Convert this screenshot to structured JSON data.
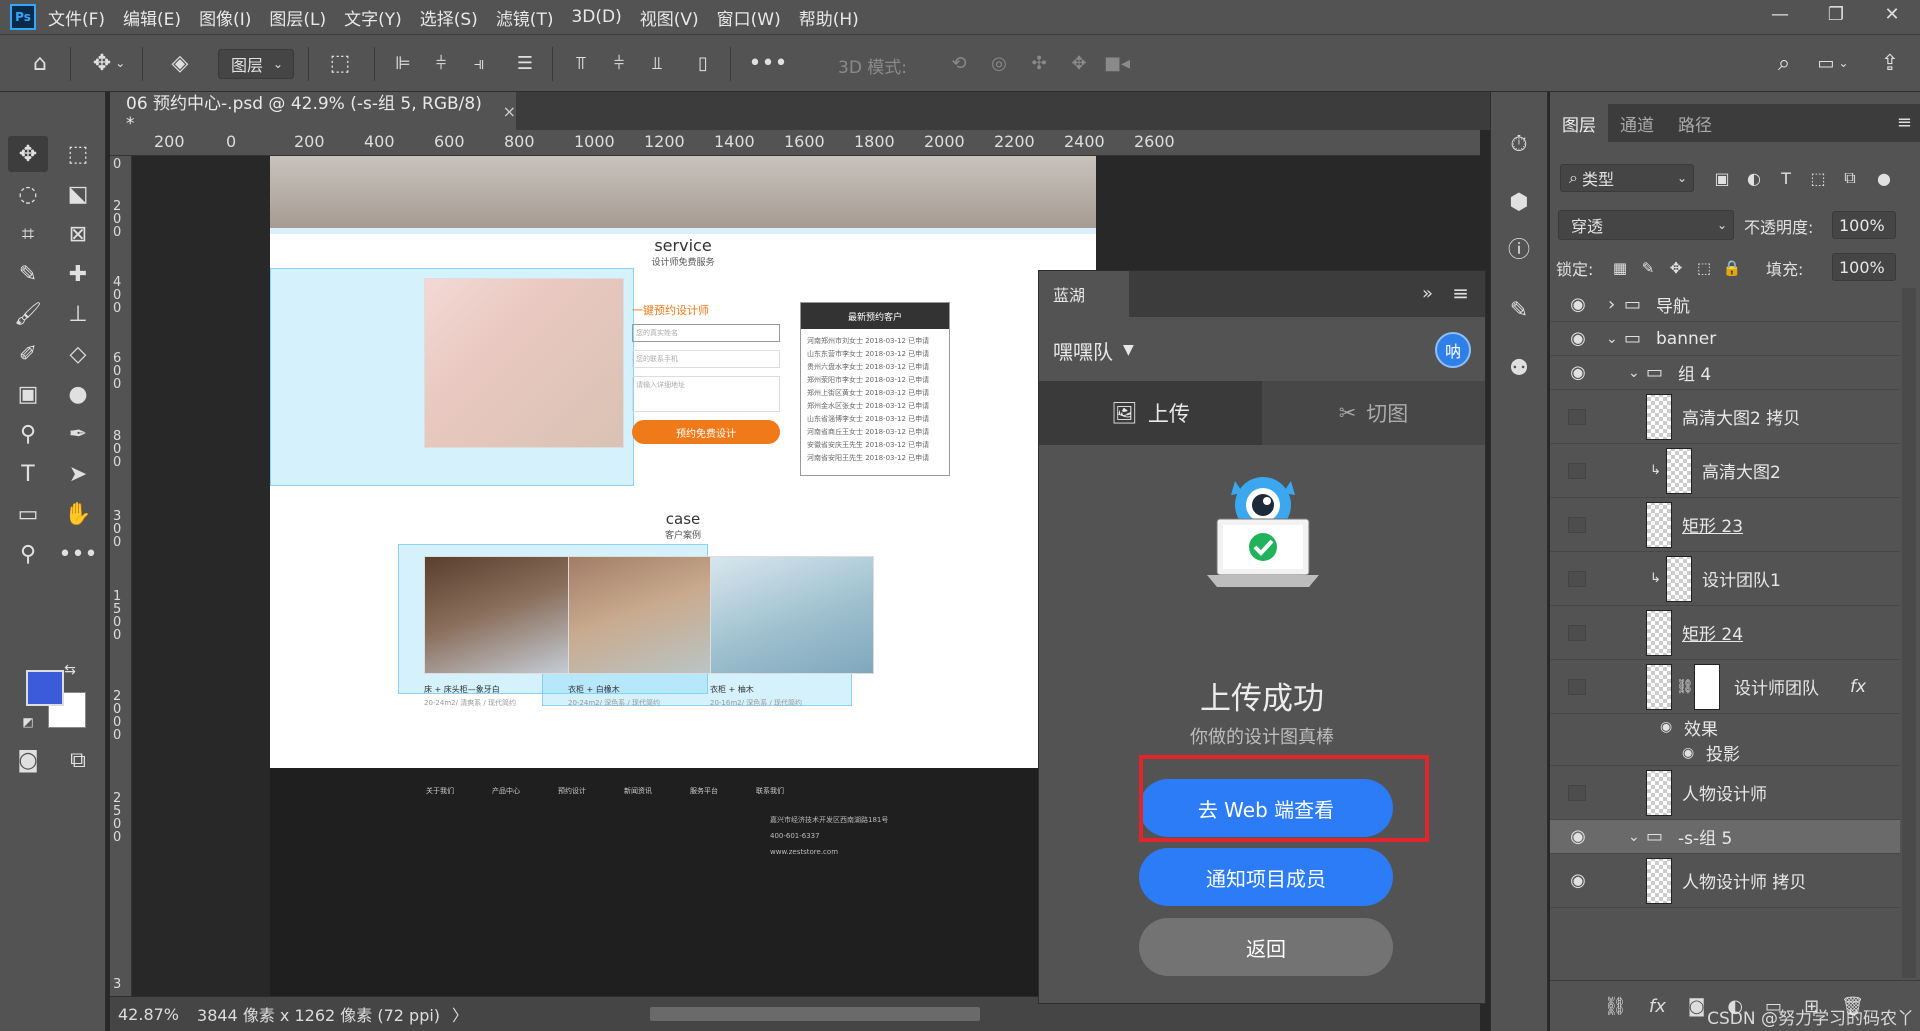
{
  "app": {
    "name": "Ps",
    "menus": [
      "文件(F)",
      "编辑(E)",
      "图像(I)",
      "图层(L)",
      "文字(Y)",
      "选择(S)",
      "滤镜(T)",
      "3D(D)",
      "视图(V)",
      "窗口(W)",
      "帮助(H)"
    ]
  },
  "window_controls": {
    "minimize": "—",
    "restore": "❐",
    "close": "✕"
  },
  "options_bar": {
    "auto_select_target": "图层",
    "mode_3d_label": "3D 模式:"
  },
  "document": {
    "tab_title": "06 预约中心-.psd @ 42.9% (-s-组 5, RGB/8) *",
    "close": "×"
  },
  "ruler": {
    "h_ticks": [
      "200",
      "0",
      "200",
      "400",
      "600",
      "800",
      "1000",
      "1200",
      "1400",
      "1600",
      "1800",
      "2000",
      "2200",
      "2400",
      "2600"
    ],
    "v_ticks": [
      "0",
      "2 0 0",
      "4 0 0",
      "6 0 0",
      "8 0 0",
      "3 0 0",
      "1 5 0 0",
      "2 0 0 0",
      "2 5 0 0",
      "3"
    ]
  },
  "status_bar": {
    "zoom": "42.87%",
    "doc_info": "3844 像素 x 1262 像素 (72 ppi)",
    "arrow": "〉"
  },
  "canvas": {
    "service_title": "service",
    "service_sub": "设计师免费服务",
    "booking_title": "一键预约设计师",
    "booking_name_ph": "您的真实姓名",
    "booking_phone_ph": "您的联系手机",
    "booking_addr_ph": "请输入详细地址",
    "booking_btn": "预约免费设计",
    "recent_title": "最新预约客户",
    "recent_rows": [
      "河南郑州市刘女士 2018-03-12 已申请",
      "山东东营市李女士 2018-03-12 已申请",
      "贵州六盘水李女士 2018-03-12 已申请",
      "郑州荥阳市李女士 2018-03-12 已申请",
      "郑州上街区黄女士 2018-03-12 已申请",
      "郑州金水区张女士 2018-03-12 已申请",
      "山东省淄博李女士 2018-03-12 已申请",
      "河南省商丘王女士 2018-03-12 已申请",
      "安徽省安庆王先生 2018-03-12 已申请",
      "河南省安阳王先生 2018-03-12 已申请"
    ],
    "case_title": "case",
    "case_sub": "客户案例",
    "cases": [
      {
        "title": "床 + 床头柜—象牙白",
        "desc": "20-24m2/ 清爽系 / 现代简约"
      },
      {
        "title": "衣柜 + 白橡木",
        "desc": "20-24m2/ 深色系 / 现代简约"
      },
      {
        "title": "衣柜 + 柚木",
        "desc": "20-16m2/ 深色系 / 现代简约"
      }
    ],
    "footer_cols": [
      "关于我们",
      "产品中心",
      "预约设计",
      "新闻资讯",
      "服务平台",
      "联系我们"
    ],
    "footer_address": "嘉兴市经济技术开发区西南湖路181号",
    "footer_phone": "400-601-6337",
    "footer_site": "www.zeststore.com"
  },
  "plugin": {
    "tab": "蓝湖",
    "expand": "»",
    "menu": "≡",
    "team": "嘿嘿队",
    "team_avatar": "呐",
    "tab_upload": "上传",
    "tab_slice": "切图",
    "success_title": "上传成功",
    "success_sub": "你做的设计图真棒",
    "btn_web": "去 Web 端查看",
    "btn_notify": "通知项目成员",
    "btn_back": "返回"
  },
  "layers_panel": {
    "tabs": [
      "图层",
      "通道",
      "路径"
    ],
    "kind": "类型",
    "blend": "穿透",
    "opacity_label": "不透明度:",
    "opacity": "100%",
    "lock_label": "锁定:",
    "fill_label": "填充:",
    "fill": "100%",
    "layers": [
      {
        "name": "导航",
        "visible": true
      },
      {
        "name": "banner",
        "visible": true
      },
      {
        "name": "组 4",
        "visible": true
      },
      {
        "name": "高清大图2 拷贝",
        "visible": false
      },
      {
        "name": "高清大图2",
        "visible": false
      },
      {
        "name": "矩形 23",
        "visible": false
      },
      {
        "name": "设计团队1",
        "visible": false
      },
      {
        "name": "矩形 24",
        "visible": false
      },
      {
        "name": "设计师团队",
        "visible": false,
        "fx": "fx"
      },
      {
        "name": "效果"
      },
      {
        "name": "投影"
      },
      {
        "name": "人物设计师",
        "visible": false
      },
      {
        "name": "-s-组 5",
        "visible": true
      },
      {
        "name": "人物设计师 拷贝",
        "visible": true
      }
    ]
  },
  "watermark": "CSDN @努力学习的码农丫"
}
